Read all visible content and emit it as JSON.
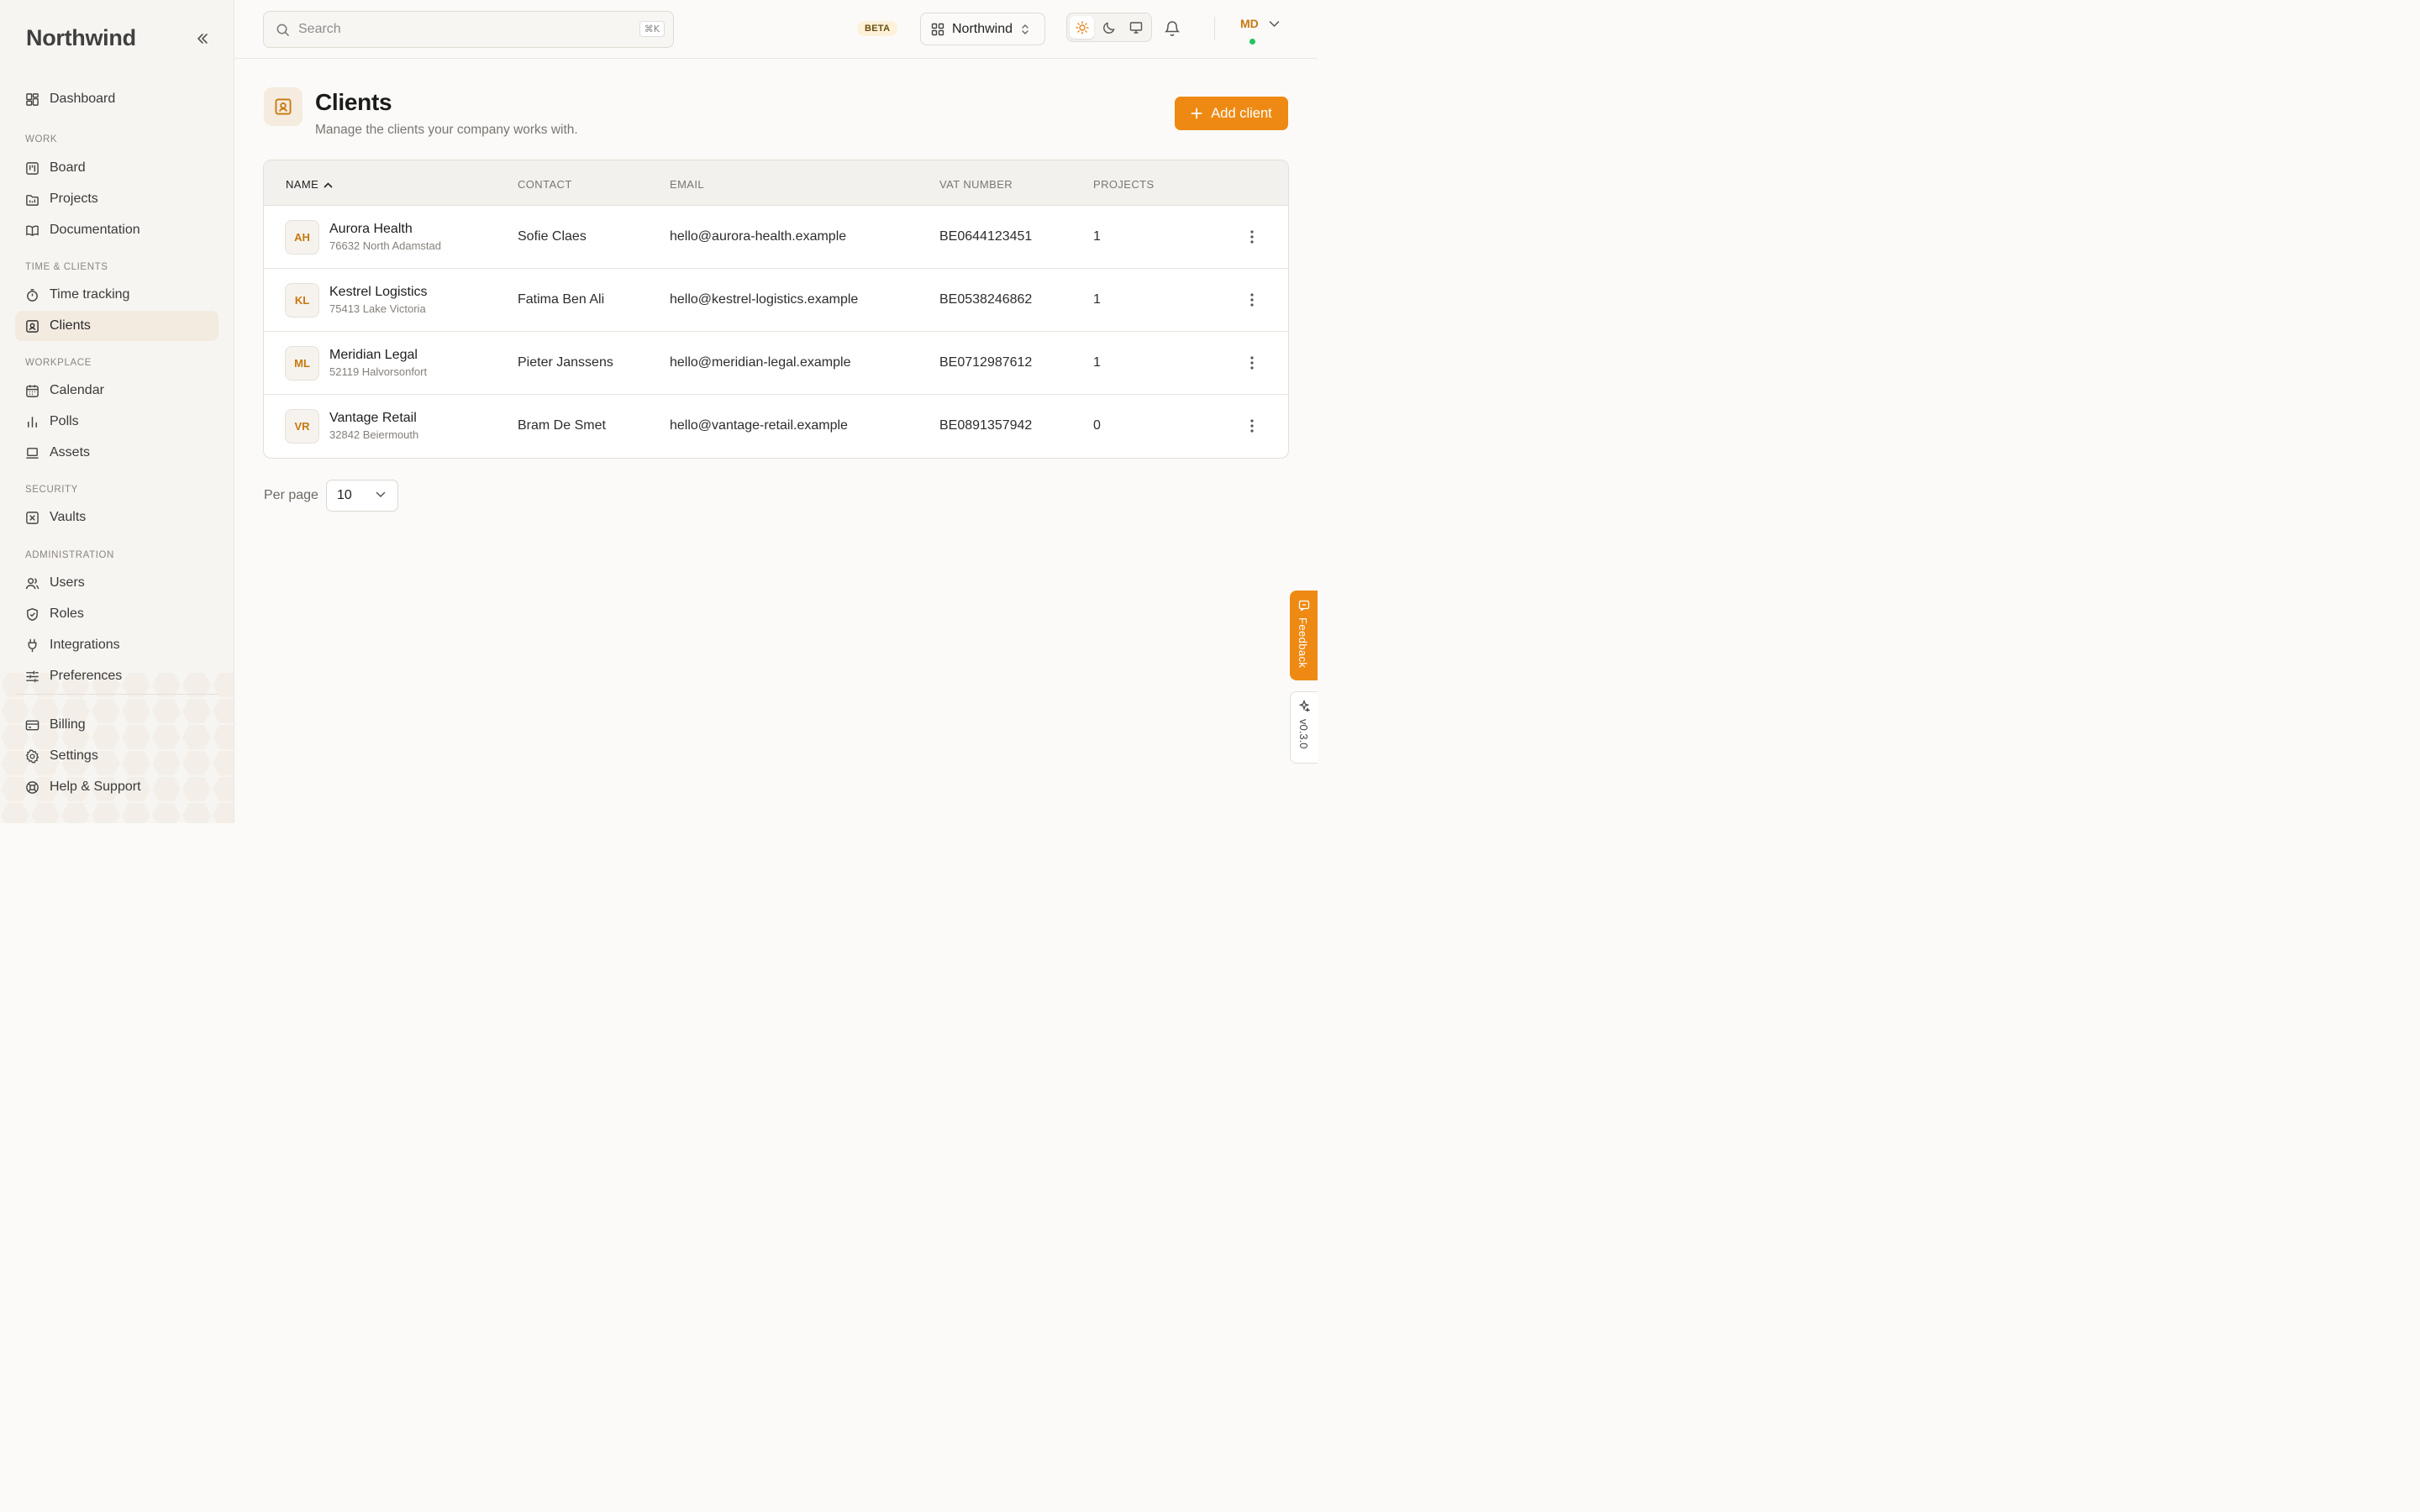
{
  "sidebar": {
    "brand": "Northwind",
    "top_item": {
      "label": "Dashboard",
      "icon": "dashboard-icon"
    },
    "sections": [
      {
        "label": "WORK",
        "items": [
          {
            "label": "Board",
            "icon": "board-icon"
          },
          {
            "label": "Projects",
            "icon": "projects-icon"
          },
          {
            "label": "Documentation",
            "icon": "book-icon"
          }
        ]
      },
      {
        "label": "TIME & CLIENTS",
        "items": [
          {
            "label": "Time tracking",
            "icon": "stopwatch-icon"
          },
          {
            "label": "Clients",
            "icon": "contact-card-icon",
            "active": true
          }
        ]
      },
      {
        "label": "WORKPLACE",
        "items": [
          {
            "label": "Calendar",
            "icon": "calendar-icon"
          },
          {
            "label": "Polls",
            "icon": "bar-chart-icon"
          },
          {
            "label": "Assets",
            "icon": "laptop-icon"
          }
        ]
      },
      {
        "label": "SECURITY",
        "items": [
          {
            "label": "Vaults",
            "icon": "vault-icon"
          }
        ]
      },
      {
        "label": "ADMINISTRATION",
        "items": [
          {
            "label": "Users",
            "icon": "users-icon"
          },
          {
            "label": "Roles",
            "icon": "shield-icon"
          },
          {
            "label": "Integrations",
            "icon": "plug-icon"
          },
          {
            "label": "Preferences",
            "icon": "sliders-icon"
          }
        ]
      }
    ],
    "bottom_items": [
      {
        "label": "Billing",
        "icon": "credit-card-icon"
      },
      {
        "label": "Settings",
        "icon": "gear-icon"
      },
      {
        "label": "Help & Support",
        "icon": "lifebuoy-icon"
      }
    ]
  },
  "topbar": {
    "search_placeholder": "Search",
    "search_shortcut": "⌘K",
    "beta_badge": "BETA",
    "workspace_name": "Northwind",
    "theme_modes": [
      "light",
      "dark",
      "system"
    ],
    "active_theme": "light",
    "user_initials": "MD",
    "user_status": "online"
  },
  "page": {
    "title": "Clients",
    "subtitle": "Manage the clients your company works with.",
    "add_button": "Add client"
  },
  "table": {
    "columns": [
      "NAME",
      "CONTACT",
      "EMAIL",
      "VAT NUMBER",
      "PROJECTS"
    ],
    "sorted_by": "NAME",
    "sort_dir": "asc",
    "rows": [
      {
        "initials": "AH",
        "name": "Aurora Health",
        "address": "76632 North Adamstad",
        "contact": "Sofie Claes",
        "email": "hello@aurora-health.example",
        "vat": "BE0644123451",
        "projects": "1"
      },
      {
        "initials": "KL",
        "name": "Kestrel Logistics",
        "address": "75413 Lake Victoria",
        "contact": "Fatima Ben Ali",
        "email": "hello@kestrel-logistics.example",
        "vat": "BE0538246862",
        "projects": "1"
      },
      {
        "initials": "ML",
        "name": "Meridian Legal",
        "address": "52119 Halvorsonfort",
        "contact": "Pieter Janssens",
        "email": "hello@meridian-legal.example",
        "vat": "BE0712987612",
        "projects": "1"
      },
      {
        "initials": "VR",
        "name": "Vantage Retail",
        "address": "32842 Beiermouth",
        "contact": "Bram De Smet",
        "email": "hello@vantage-retail.example",
        "vat": "BE0891357942",
        "projects": "0"
      }
    ]
  },
  "pagination": {
    "per_page_label": "Per page",
    "per_page_value": "10"
  },
  "side_tabs": {
    "feedback": "Feedback",
    "version": "v0.3.0"
  },
  "colors": {
    "accent": "#ee8a14",
    "accent_text": "#c7780f",
    "active_nav_bg": "#f3ebe0",
    "online": "#22c55e"
  }
}
